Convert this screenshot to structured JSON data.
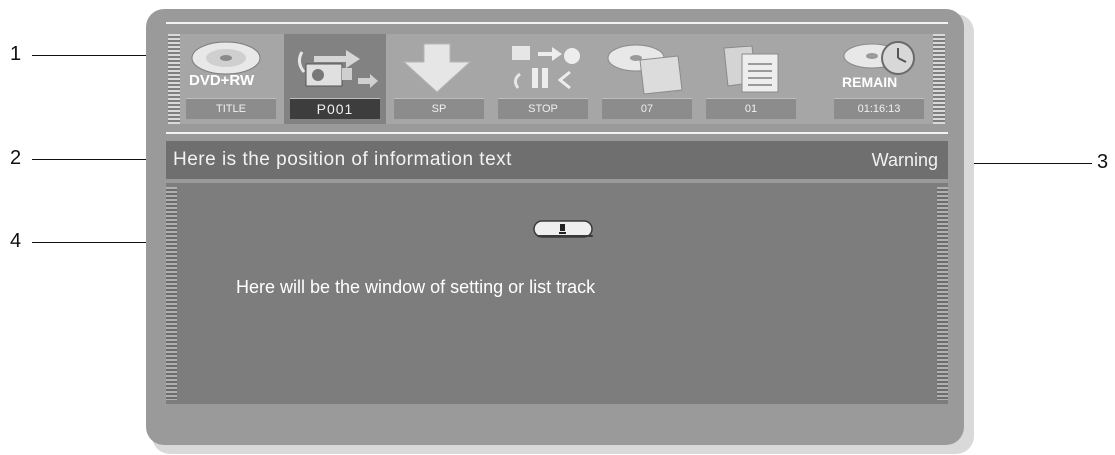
{
  "callouts": [
    "1",
    "2",
    "3",
    "4"
  ],
  "toolbar": {
    "disc_type": "DVD+RW",
    "remain_label": "REMAIN",
    "items": [
      {
        "icon": "disc-icon",
        "label": "TITLE",
        "selected": false
      },
      {
        "icon": "camcorder-transfer-icon",
        "label": "P001",
        "selected": true
      },
      {
        "icon": "down-arrow-icon",
        "label": "SP",
        "selected": false
      },
      {
        "icon": "playback-control-icon",
        "label": "STOP",
        "selected": false
      },
      {
        "icon": "disc-folder-icon",
        "label": "07",
        "selected": false
      },
      {
        "icon": "document-folder-icon",
        "label": "01",
        "selected": false
      },
      {
        "icon": "remain-clock-icon",
        "label": "01:16:13",
        "selected": false
      }
    ]
  },
  "info_bar": {
    "text": "Here is the position of information text",
    "warning": "Warning"
  },
  "window": {
    "text": "Here will be the window of setting or list track",
    "icon": "exclamation-icon"
  }
}
